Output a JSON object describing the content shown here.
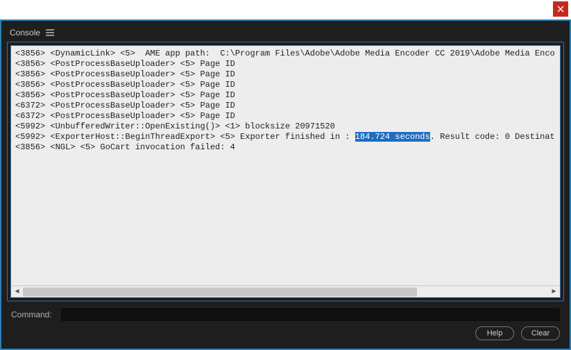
{
  "window": {
    "close_icon": "close-icon"
  },
  "panel": {
    "tab_label": "Console",
    "menu_icon": "menu-icon"
  },
  "console": {
    "highlight": "184.724 seconds",
    "lines": [
      {
        "pid": "<3856>",
        "src": "<DynamicLink>",
        "lvl": "<5>",
        "msg": " AME app path:  C:\\Program Files\\Adobe\\Adobe Media Encoder CC 2019\\Adobe Media Enco"
      },
      {
        "pid": "<3856>",
        "src": "<PostProcessBaseUploader>",
        "lvl": "<5>",
        "msg": "Page ID"
      },
      {
        "pid": "<3856>",
        "src": "<PostProcessBaseUploader>",
        "lvl": "<5>",
        "msg": "Page ID"
      },
      {
        "pid": "<3856>",
        "src": "<PostProcessBaseUploader>",
        "lvl": "<5>",
        "msg": "Page ID"
      },
      {
        "pid": "<3856>",
        "src": "<PostProcessBaseUploader>",
        "lvl": "<5>",
        "msg": "Page ID"
      },
      {
        "pid": "<6372>",
        "src": "<PostProcessBaseUploader>",
        "lvl": "<5>",
        "msg": "Page ID"
      },
      {
        "pid": "<6372>",
        "src": "<PostProcessBaseUploader>",
        "lvl": "<5>",
        "msg": "Page ID"
      },
      {
        "pid": "<5992>",
        "src": "<UnbufferedWriter::OpenExisting()>",
        "lvl": "<1>",
        "msg": "blocksize 20971520"
      },
      {
        "pid": "<5992>",
        "src": "<ExporterHost::BeginThreadExport>",
        "lvl": "<5>",
        "msg": "Exporter finished in : {{HL}}. Result code: 0 Destinat"
      },
      {
        "pid": "<3856>",
        "src": "<NGL>",
        "lvl": "<5>",
        "msg": "GoCart invocation failed: 4"
      }
    ]
  },
  "command": {
    "label": "Command:",
    "value": ""
  },
  "buttons": {
    "help": "Help",
    "clear": "Clear"
  }
}
